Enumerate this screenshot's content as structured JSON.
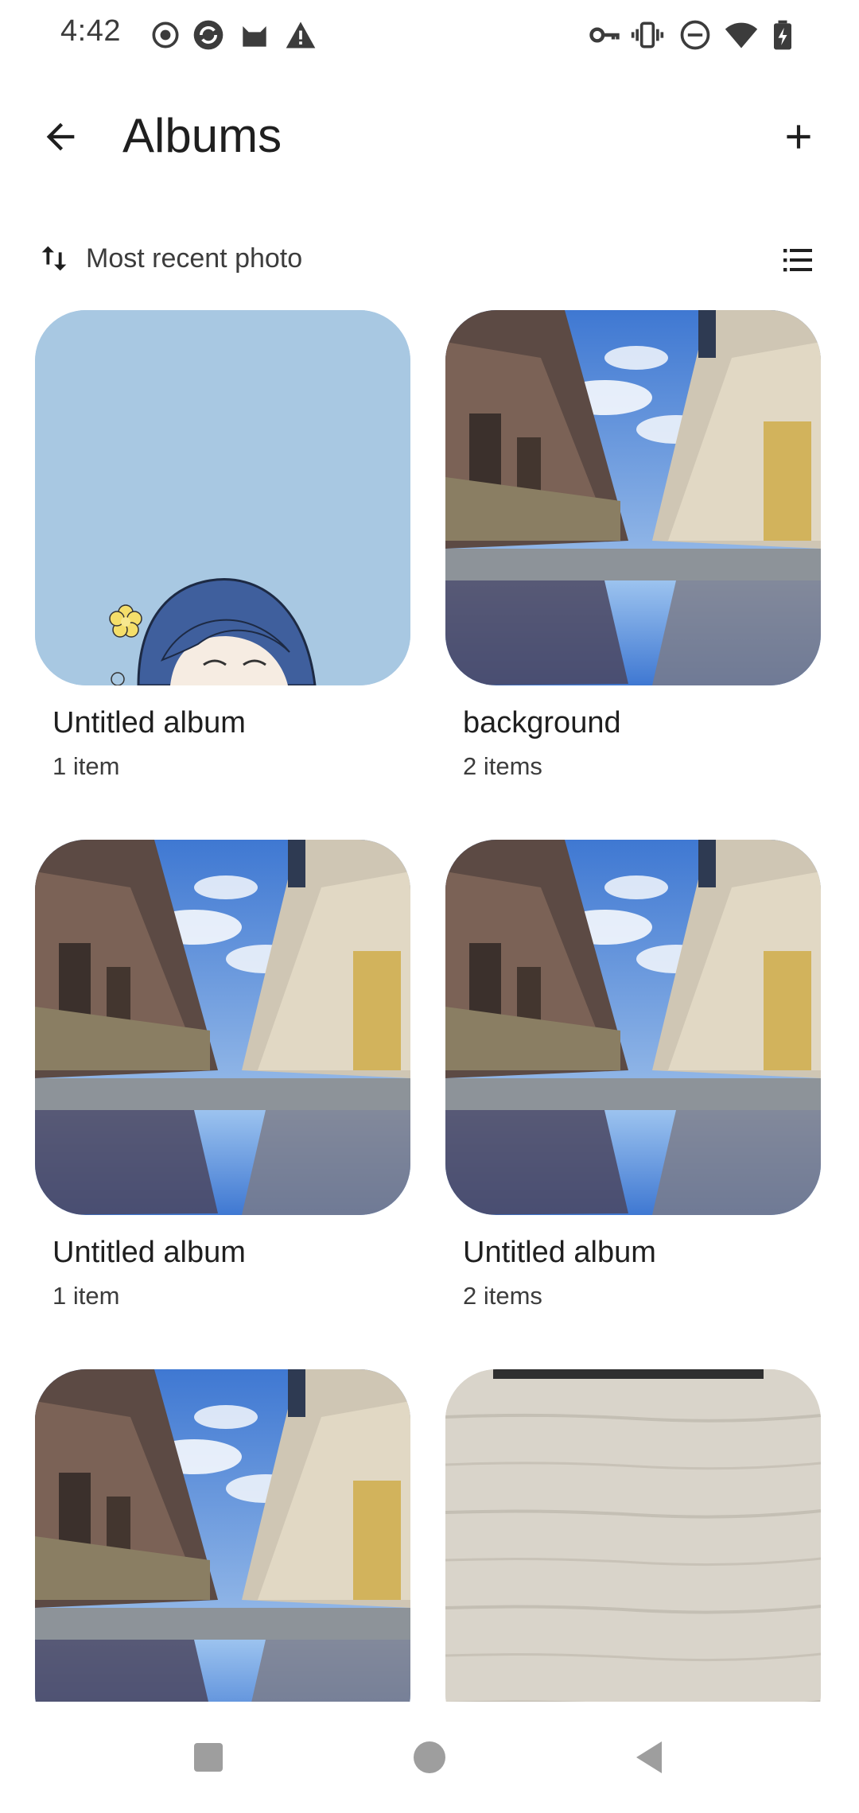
{
  "status_bar": {
    "time": "4:42",
    "left_icons": [
      "record-icon",
      "sync-icon",
      "cat-app-icon",
      "warning-icon"
    ],
    "right_icons": [
      "vpn-key-icon",
      "vibrate-icon",
      "do-not-disturb-icon",
      "wifi-icon",
      "battery-charging-icon"
    ]
  },
  "app_bar": {
    "title": "Albums",
    "back_icon": "arrow-back-icon",
    "add_icon": "add-icon"
  },
  "sort": {
    "label": "Most recent photo",
    "icon": "sort-icon",
    "view_icon": "list-view-icon"
  },
  "albums": [
    {
      "title": "Untitled album",
      "count": "1 item",
      "thumb": "anime-character"
    },
    {
      "title": "background",
      "count": "2 items",
      "thumb": "street"
    },
    {
      "title": "Untitled album",
      "count": "1 item",
      "thumb": "street"
    },
    {
      "title": "Untitled album",
      "count": "2 items",
      "thumb": "street"
    },
    {
      "title": "",
      "count": "",
      "thumb": "street"
    },
    {
      "title": "",
      "count": "",
      "thumb": "wood"
    }
  ],
  "nav_bar": {
    "buttons": [
      "recents-square-icon",
      "home-circle-icon",
      "back-triangle-icon"
    ]
  },
  "colors": {
    "sky_blue": "#a8c8e2",
    "text_primary": "#1f1f1f",
    "text_secondary": "#3c3c3c",
    "nav_gray": "#9e9e9e"
  }
}
